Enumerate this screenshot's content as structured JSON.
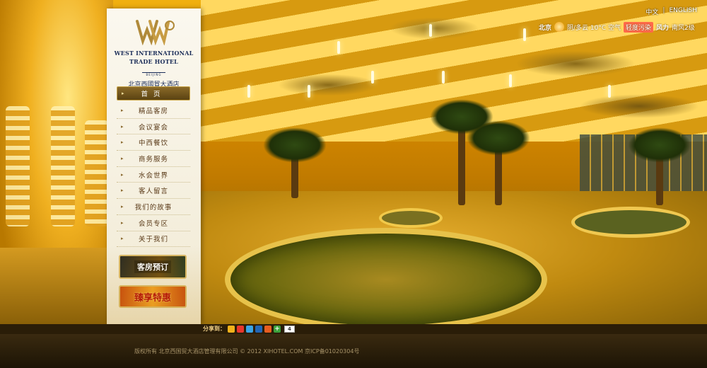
{
  "language": {
    "chinese": "中文",
    "separator": "|",
    "english": "ENGLISH"
  },
  "weather": {
    "city": "北京",
    "condition": "阴/多云 10°C 空气",
    "aqi": "轻度污染",
    "wind_label": "风力",
    "wind_value": "南风2级"
  },
  "logo": {
    "line1": "WEST INTERNATIONAL",
    "line2": "TRADE HOTEL",
    "city": "BEIJING",
    "cn": "北京西國貿大酒店"
  },
  "nav": {
    "items": [
      {
        "label": "首页"
      },
      {
        "label": "精品客房"
      },
      {
        "label": "会议宴会"
      },
      {
        "label": "中西餐饮"
      },
      {
        "label": "商务服务"
      },
      {
        "label": "水会世界"
      },
      {
        "label": "客人留言"
      },
      {
        "label": "我们的故事"
      },
      {
        "label": "会员专区"
      },
      {
        "label": "关于我们"
      }
    ]
  },
  "promos": {
    "booking": "客房预订",
    "offer": "臻享特惠"
  },
  "share": {
    "label": "分享到：",
    "count": "4",
    "icons": [
      {
        "name": "qzone-icon",
        "color": "#f2b21b"
      },
      {
        "name": "sina-weibo-icon",
        "color": "#e8362d"
      },
      {
        "name": "tencent-weibo-icon",
        "color": "#3aa4e6"
      },
      {
        "name": "renren-icon",
        "color": "#2366b5"
      },
      {
        "name": "kaixin-icon",
        "color": "#e85d20"
      },
      {
        "name": "more-icon",
        "color": "#3ca23c"
      }
    ]
  },
  "footer": {
    "copyright": "版权所有 北京西国贸大酒店管理有限公司 © 2012 XIHOTEL.COM  京ICP备01020304号"
  }
}
